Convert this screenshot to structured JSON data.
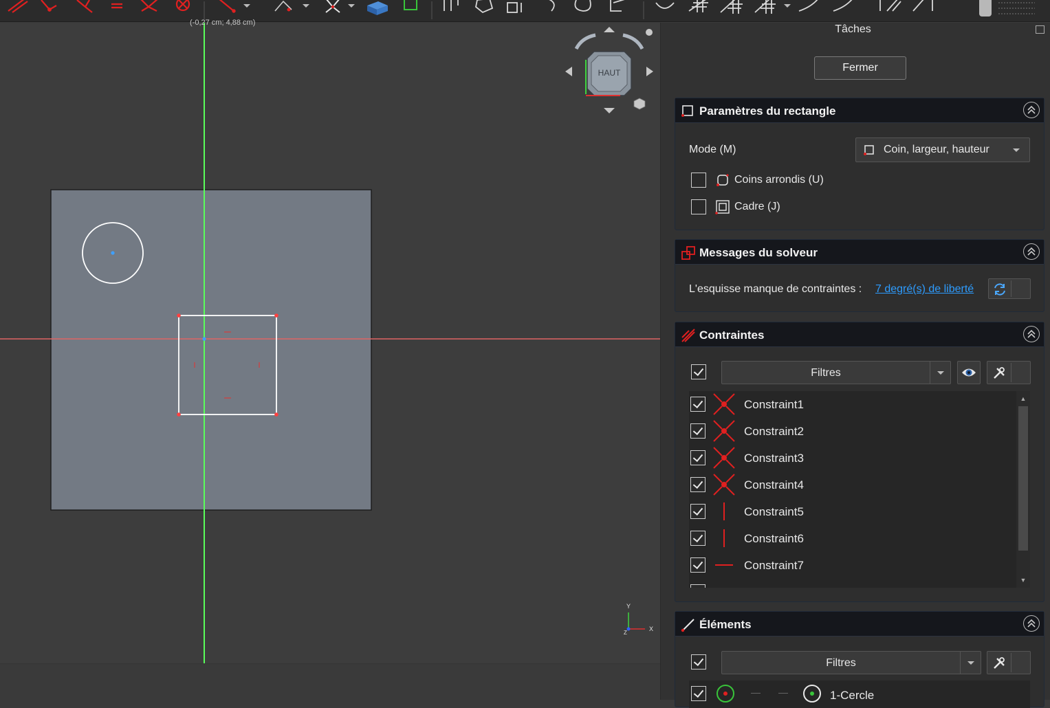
{
  "viewport": {
    "coord_readout": "(-0,27 cm; 4,88 cm)",
    "navcube_face": "HAUT",
    "axis_labels": {
      "y": "Y",
      "x": "X",
      "z": "Z"
    }
  },
  "taskpanel": {
    "title": "Tâches",
    "close_label": "Fermer",
    "rectangle_params": {
      "title": "Paramètres du rectangle",
      "mode_label": "Mode (M)",
      "mode_value": "Coin, largeur, hauteur",
      "rounded_label": "Coins arrondis (U)",
      "frame_label": "Cadre (J)"
    },
    "solver": {
      "title": "Messages du solveur",
      "message": "L'esquisse manque de contraintes :",
      "dof_link": "7 degré(s) de liberté"
    },
    "constraints": {
      "title": "Contraintes",
      "filter_label": "Filtres",
      "items": [
        {
          "name": "Constraint1",
          "kind": "coincident"
        },
        {
          "name": "Constraint2",
          "kind": "coincident"
        },
        {
          "name": "Constraint3",
          "kind": "coincident"
        },
        {
          "name": "Constraint4",
          "kind": "coincident"
        },
        {
          "name": "Constraint5",
          "kind": "vertical"
        },
        {
          "name": "Constraint6",
          "kind": "vertical"
        },
        {
          "name": "Constraint7",
          "kind": "horizontal"
        }
      ]
    },
    "elements": {
      "title": "Éléments",
      "filter_label": "Filtres",
      "first_item": "1-Cercle"
    }
  },
  "colors": {
    "accent_red": "#e02020",
    "y_axis": "#5aff5a",
    "x_axis": "#e06464",
    "sketch_plane": "#737a84",
    "link_blue": "#2d9cff"
  }
}
